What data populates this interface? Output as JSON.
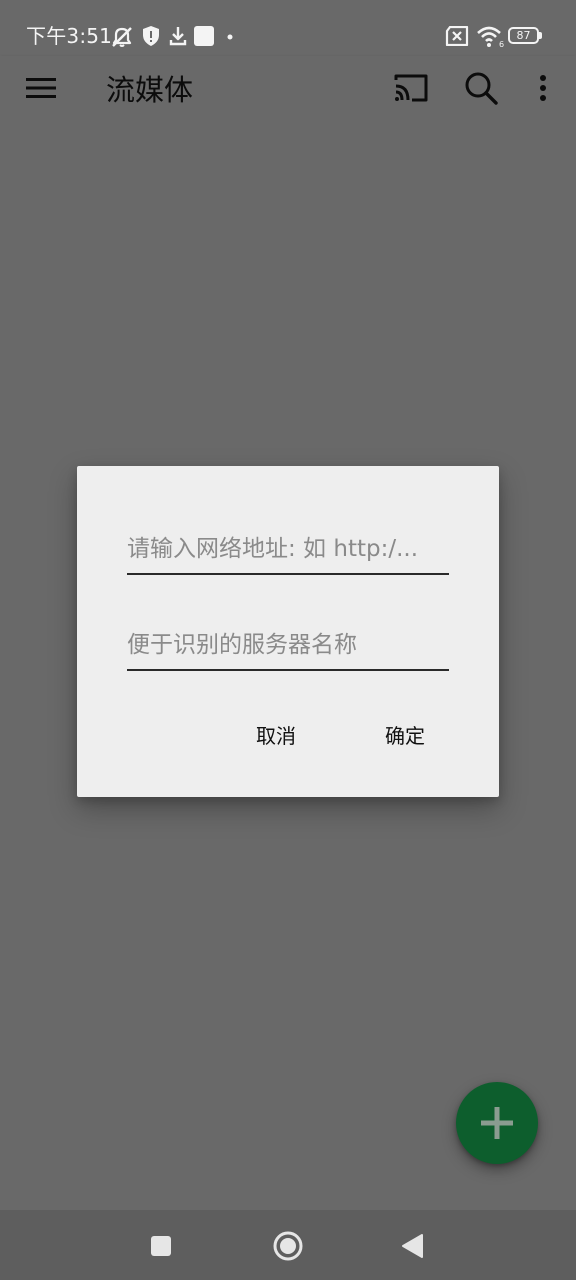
{
  "status_bar": {
    "time": "下午3:51",
    "battery": "87",
    "icons": [
      "muted-bell-icon",
      "shield-icon",
      "download-icon",
      "white-square-icon",
      "dot-icon",
      "sim-x-icon",
      "wifi-icon",
      "battery-icon"
    ]
  },
  "app_bar": {
    "title": "流媒体",
    "icons": [
      "menu-icon",
      "cast-icon",
      "search-icon",
      "more-vert-icon"
    ]
  },
  "dialog": {
    "url_input": {
      "value": "",
      "placeholder": "请输入网络地址: 如 http:/..."
    },
    "name_input": {
      "value": "",
      "placeholder": "便于识别的服务器名称"
    },
    "cancel_label": "取消",
    "confirm_label": "确定"
  },
  "fab": {
    "icon": "plus-icon"
  },
  "nav_bar": {
    "icons": [
      "recent-apps-icon",
      "home-icon",
      "back-icon"
    ]
  },
  "colors": {
    "background": "#696969",
    "dialog": "#eeeeee",
    "fab": "#0d5e2d",
    "nav_bar": "#5e5e5e"
  }
}
